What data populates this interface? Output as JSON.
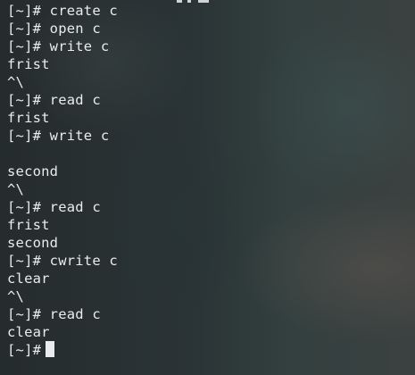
{
  "terminal": {
    "lines": [
      "[~]# create c",
      "[~]# open c",
      "[~]# write c",
      "frist",
      "^\\",
      "[~]# read c",
      "frist",
      "[~]# write c",
      "",
      "second",
      "^\\",
      "[~]# read c",
      "frist",
      "second",
      "[~]# cwrite c",
      "clear",
      "^\\",
      "[~]# read c",
      "clear",
      "[~]#"
    ]
  },
  "colors": {
    "text": "#e9ecec",
    "background": "#1f2628",
    "cursor": "#e9ecec"
  },
  "icons": {
    "cursor": "block-cursor"
  }
}
